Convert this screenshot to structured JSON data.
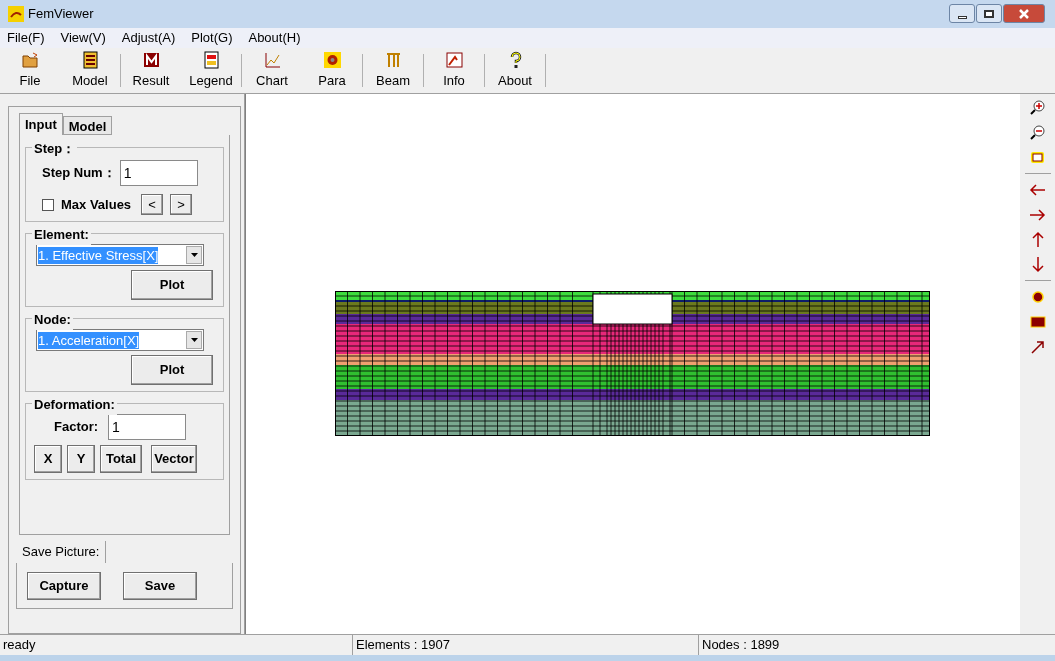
{
  "window": {
    "title": "FemViewer"
  },
  "menu": [
    "File(F)",
    "View(V)",
    "Adjust(A)",
    "Plot(G)",
    "About(H)"
  ],
  "toolbar": [
    {
      "label": "File"
    },
    {
      "label": "Model"
    },
    {
      "label": "Result"
    },
    {
      "label": "Legend"
    },
    {
      "label": "Chart"
    },
    {
      "label": "Para"
    },
    {
      "label": "Beam"
    },
    {
      "label": "Info"
    },
    {
      "label": "About"
    }
  ],
  "panel": {
    "tabs": [
      {
        "label": "Input",
        "selected": true
      },
      {
        "label": "Model",
        "selected": false
      }
    ],
    "step": {
      "title": "Step：",
      "label": "Step Num：",
      "value": "1",
      "max_values": {
        "label": "Max Values",
        "checked": false
      },
      "prev": "<",
      "next": ">"
    },
    "element": {
      "title": "Element:",
      "value": "1. Effective Stress[X]",
      "button": "Plot"
    },
    "node": {
      "title": "Node:",
      "value": "1. Acceleration[X]",
      "button": "Plot"
    },
    "deformation": {
      "title": "Deformation:",
      "label": "Factor:",
      "value": "1",
      "buttons": [
        "X",
        "Y",
        "Total",
        "Vector"
      ]
    },
    "save": {
      "tab": "Save Picture:",
      "buttons": [
        "Capture",
        "Save"
      ]
    }
  },
  "status_bar": [
    "ready",
    "Elements : 1907",
    "Nodes : 1899"
  ]
}
